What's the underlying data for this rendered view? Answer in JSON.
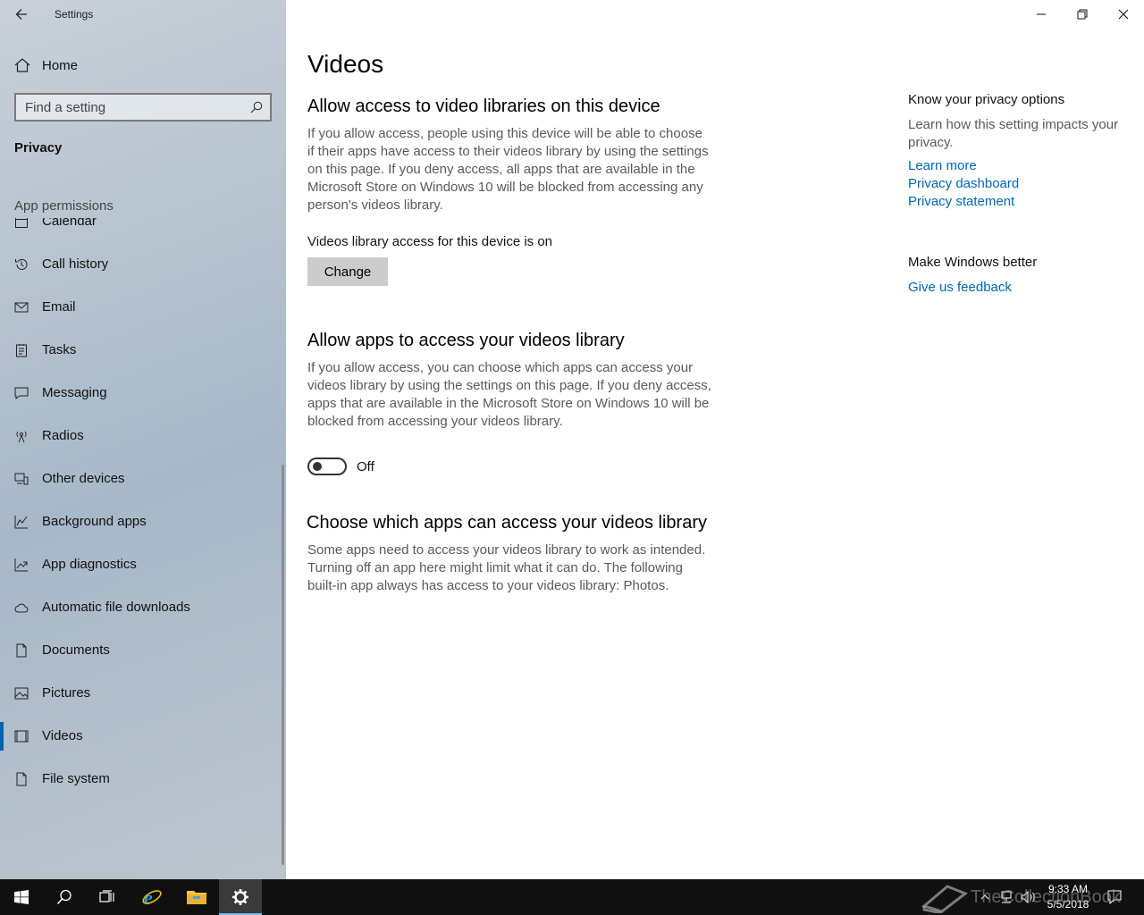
{
  "window": {
    "app_title": "Settings"
  },
  "sidebar": {
    "home_label": "Home",
    "search_placeholder": "Find a setting",
    "section_title": "Privacy",
    "group_title": "App permissions",
    "items": [
      {
        "label": "Calendar",
        "icon": "calendar-icon"
      },
      {
        "label": "Call history",
        "icon": "history-icon"
      },
      {
        "label": "Email",
        "icon": "mail-icon"
      },
      {
        "label": "Tasks",
        "icon": "tasks-icon"
      },
      {
        "label": "Messaging",
        "icon": "message-icon"
      },
      {
        "label": "Radios",
        "icon": "antenna-icon"
      },
      {
        "label": "Other devices",
        "icon": "devices-icon"
      },
      {
        "label": "Background apps",
        "icon": "chart-icon"
      },
      {
        "label": "App diagnostics",
        "icon": "diagnostics-icon"
      },
      {
        "label": "Automatic file downloads",
        "icon": "cloud-icon"
      },
      {
        "label": "Documents",
        "icon": "document-icon"
      },
      {
        "label": "Pictures",
        "icon": "picture-icon"
      },
      {
        "label": "Videos",
        "icon": "video-icon",
        "active": true
      },
      {
        "label": "File system",
        "icon": "file-icon"
      }
    ]
  },
  "main": {
    "page_title": "Videos",
    "section1": {
      "heading": "Allow access to video libraries on this device",
      "description": "If you allow access, people using this device will be able to choose if their apps have access to their videos library by using the settings on this page. If you deny access, all apps that are available in the Microsoft Store on Windows 10 will be blocked from accessing any person's videos library.",
      "status": "Videos library access for this device is on",
      "button_label": "Change"
    },
    "section2": {
      "heading": "Allow apps to access your videos library",
      "description": "If you allow access, you can choose which apps can access your videos library by using the settings on this page. If you deny access, apps that are available in the Microsoft Store on Windows 10 will be blocked from accessing your videos library.",
      "toggle_state": "Off"
    },
    "section3": {
      "heading": "Choose which apps can access your videos library",
      "description": "Some apps need to access your videos library to work as intended. Turning off an app here might limit what it can do. The following built-in app always has access to your videos library: Photos."
    }
  },
  "aside": {
    "privacy_heading": "Know your privacy options",
    "privacy_desc": "Learn how this setting impacts your privacy.",
    "links": [
      "Learn more",
      "Privacy dashboard",
      "Privacy statement"
    ],
    "feedback_heading": "Make Windows better",
    "feedback_link": "Give us feedback"
  },
  "taskbar": {
    "time": "9:33 AM",
    "date": "5/5/2018",
    "watermark": "TheCollectionBook"
  },
  "colors": {
    "accent": "#0063b1",
    "link": "#0067b8",
    "taskbar": "#101010"
  }
}
